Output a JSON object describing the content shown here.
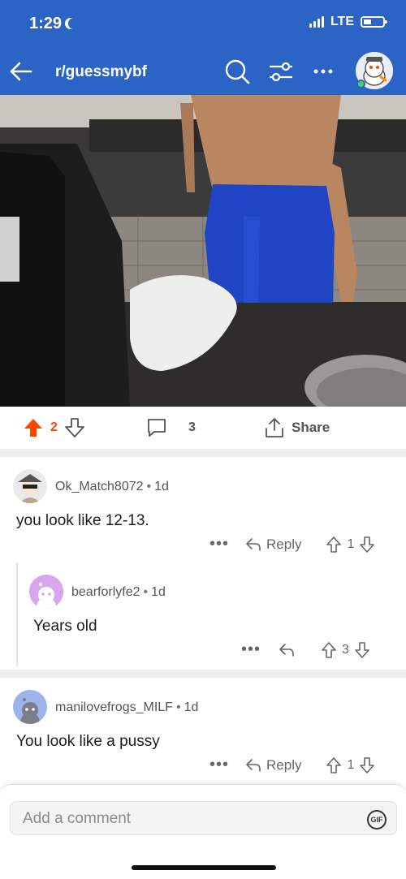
{
  "status": {
    "time": "1:29",
    "network": "LTE"
  },
  "header": {
    "subreddit": "r/guessmybf"
  },
  "post": {
    "upvotes": "2",
    "comments": "3",
    "share_label": "Share",
    "upvote_color": "#ff4500"
  },
  "comments": [
    {
      "user": "Ok_Match8072",
      "age": "1d",
      "body": "you look like 12-13.",
      "reply_label": "Reply",
      "votes": "1"
    },
    {
      "user": "bearforlyfe2",
      "age": "1d",
      "body": "Years old",
      "votes": "3"
    },
    {
      "user": "manilovefrogs_MILF",
      "age": "1d",
      "body": "You look like a pussy",
      "reply_label": "Reply",
      "votes": "1"
    }
  ],
  "composer": {
    "placeholder": "Add a comment",
    "gif_label": "GIF"
  },
  "colors": {
    "header_bg": "#2c64c6",
    "upvote": "#ff4500",
    "bear_avatar": "#d7a6ec",
    "frog_avatar": "#9db4ea"
  }
}
